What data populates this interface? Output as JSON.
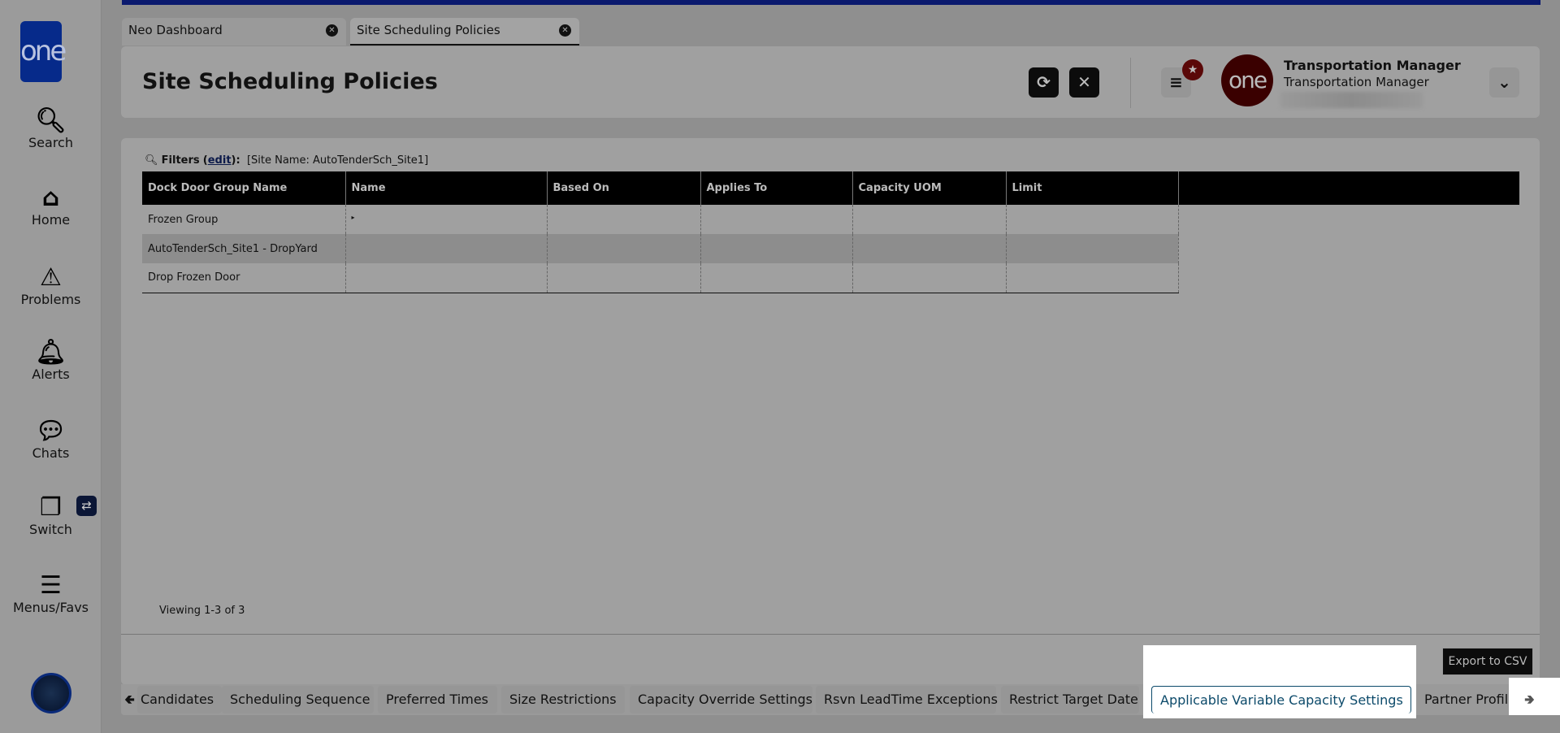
{
  "sidebar": {
    "logo": "one",
    "items": [
      {
        "label": "Search",
        "icon": "search-icon"
      },
      {
        "label": "Home",
        "icon": "home-icon"
      },
      {
        "label": "Problems",
        "icon": "warning-icon"
      },
      {
        "label": "Alerts",
        "icon": "bell-icon"
      },
      {
        "label": "Chats",
        "icon": "chat-icon"
      },
      {
        "label": "Switch",
        "icon": "switch-icon"
      },
      {
        "label": "Menus/Favs",
        "icon": "menu-icon"
      }
    ]
  },
  "tabs": [
    {
      "label": "Neo Dashboard"
    },
    {
      "label": "Site Scheduling Policies"
    }
  ],
  "header": {
    "title": "Site Scheduling Policies",
    "user_name": "Transportation Manager",
    "user_role": "Transportation Manager",
    "avatar_text": "one"
  },
  "filters": {
    "label": "Filters",
    "edit": "edit",
    "value": "[Site Name: AutoTenderSch_Site1]"
  },
  "table": {
    "columns": [
      "Dock Door Group Name",
      "Name",
      "Based On",
      "Applies To",
      "Capacity UOM",
      "Limit"
    ],
    "rows": [
      [
        "Frozen Group",
        "",
        "",
        "",
        "",
        ""
      ],
      [
        "AutoTenderSch_Site1 - DropYard",
        "",
        "",
        "",
        "",
        ""
      ],
      [
        "Drop Frozen Door",
        "",
        "",
        "",
        "",
        ""
      ]
    ]
  },
  "viewing": "Viewing 1-3 of 3",
  "export_label": "Export to CSV",
  "bottom_tabs": [
    "Candidates",
    "Scheduling Sequence",
    "Preferred Times",
    "Size Restrictions",
    "Capacity Override Settings",
    "Rsvn LeadTime Exceptions",
    "Restrict Target Date",
    "Applicable Variable Capacity Settings",
    "Partner Profile"
  ],
  "active_bottom_tab": "Applicable Variable Capacity Settings"
}
